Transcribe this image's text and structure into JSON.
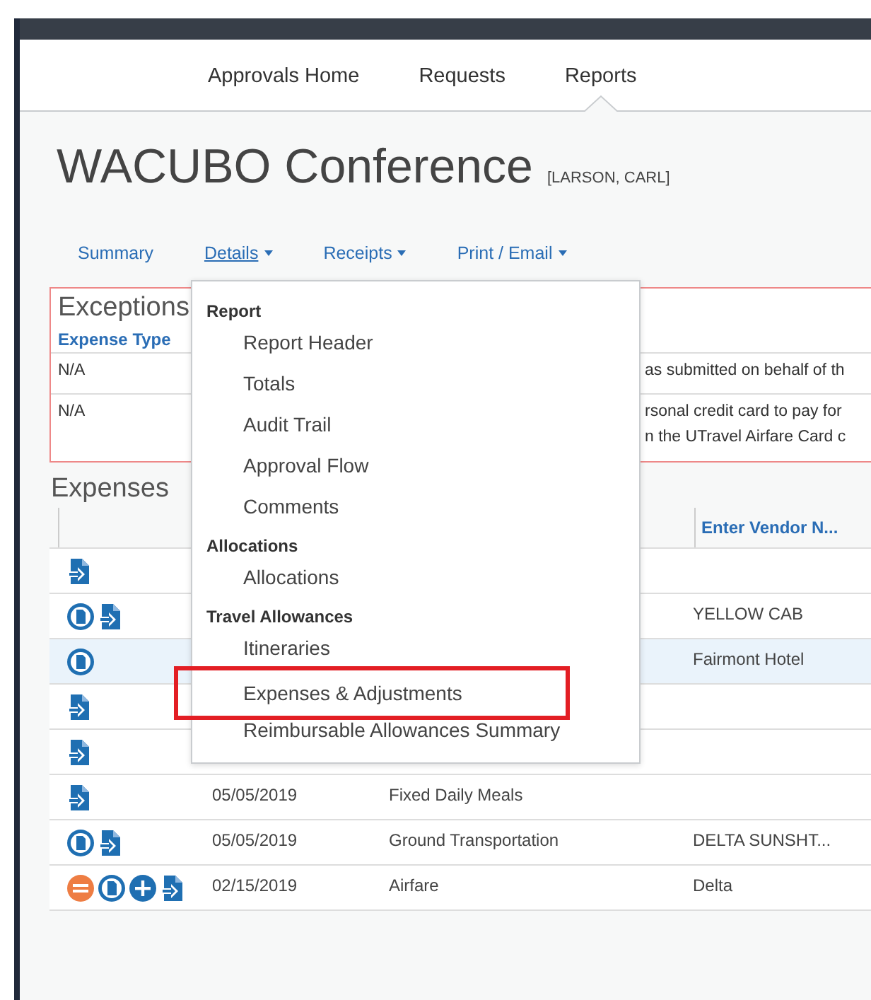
{
  "top_nav": {
    "items": [
      {
        "label": "Approvals Home",
        "selected": false
      },
      {
        "label": "Requests",
        "selected": false
      },
      {
        "label": "Reports",
        "selected": true
      }
    ]
  },
  "report": {
    "title": "WACUBO Conference",
    "employee": "[LARSON, CARL]"
  },
  "sub_tabs": [
    {
      "label": "Summary",
      "has_menu": false,
      "selected": false
    },
    {
      "label": "Details",
      "has_menu": true,
      "selected": true
    },
    {
      "label": "Receipts",
      "has_menu": true,
      "selected": false
    },
    {
      "label": "Print / Email",
      "has_menu": true,
      "selected": false
    }
  ],
  "exceptions": {
    "title": "Exceptions",
    "expense_type_column": "Expense Type",
    "rows": [
      {
        "expense_type": "N/A",
        "message": [
          "as submitted on behalf of th"
        ]
      },
      {
        "expense_type": "N/A",
        "message": [
          "rsonal credit card to pay for",
          "n the UTravel Airfare Card c"
        ]
      }
    ]
  },
  "expenses": {
    "title": "Expenses",
    "vendor_column": "Enter Vendor N...",
    "rows": [
      {
        "icons": [
          {
            "kind": "receipt"
          }
        ],
        "selected": false
      },
      {
        "icons": [
          {
            "kind": "document"
          },
          {
            "kind": "receipt"
          }
        ],
        "vendor": "YELLOW CAB",
        "selected": false
      },
      {
        "icons": [
          {
            "kind": "document"
          }
        ],
        "vendor": "Fairmont Hotel",
        "selected": true
      },
      {
        "icons": [
          {
            "kind": "receipt"
          }
        ],
        "selected": false
      },
      {
        "icons": [
          {
            "kind": "receipt"
          }
        ],
        "selected": false
      },
      {
        "icons": [
          {
            "kind": "receipt"
          }
        ],
        "date": "05/05/2019",
        "expense_type": "Fixed Daily Meals",
        "selected": false
      },
      {
        "icons": [
          {
            "kind": "document"
          },
          {
            "kind": "receipt"
          }
        ],
        "date": "05/05/2019",
        "expense_type": "Ground Transportation",
        "vendor": "DELTA SUNSHT...",
        "selected": false
      },
      {
        "icons": [
          {
            "kind": "remove"
          },
          {
            "kind": "document"
          },
          {
            "kind": "add"
          },
          {
            "kind": "receipt"
          }
        ],
        "date": "02/15/2019",
        "expense_type": "Airfare",
        "vendor": "Delta",
        "selected": false
      }
    ]
  },
  "details_menu": {
    "sections": [
      {
        "title": "Report",
        "items": [
          {
            "label": "Report Header",
            "annotated": false
          },
          {
            "label": "Totals",
            "annotated": false
          },
          {
            "label": "Audit Trail",
            "annotated": false
          },
          {
            "label": "Approval Flow",
            "annotated": false
          },
          {
            "label": "Comments",
            "annotated": false
          }
        ]
      },
      {
        "title": "Allocations",
        "items": [
          {
            "label": "Allocations",
            "annotated": false
          }
        ]
      },
      {
        "title": "Travel Allowances",
        "items": [
          {
            "label": "Itineraries",
            "annotated": false
          },
          {
            "label": "Expenses & Adjustments",
            "annotated": true
          },
          {
            "label": "Reimbursable Allowances Summary",
            "annotated": false
          }
        ]
      }
    ]
  }
}
